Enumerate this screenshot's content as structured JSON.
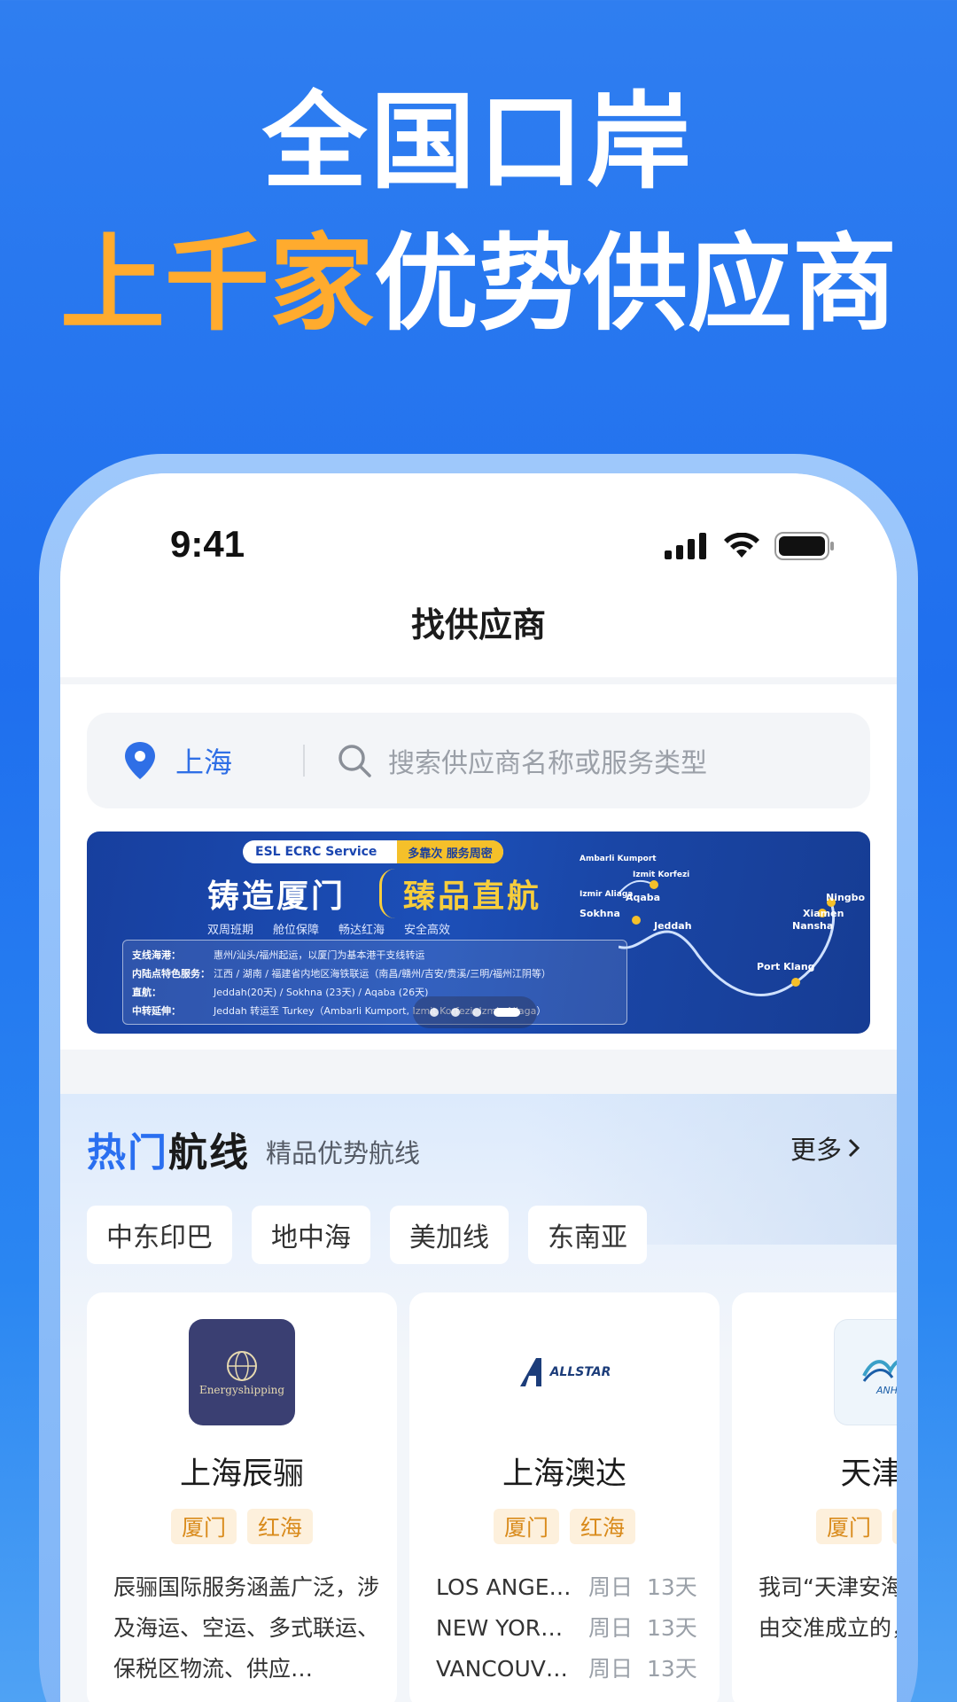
{
  "hero": {
    "line1": "全国口岸",
    "line2_accent": "上千家",
    "line2_rest": "优势供应商"
  },
  "status_bar": {
    "time": "9:41"
  },
  "nav": {
    "title": "找供应商"
  },
  "search": {
    "location": "上海",
    "placeholder": "搜索供应商名称或服务类型"
  },
  "banner": {
    "brand": "ESL",
    "service": "ECRC Service",
    "tagline": "多靠次 服务周密",
    "headline_left": "铸造厦门",
    "headline_right": "臻品直航",
    "features": [
      "双周班期",
      "舱位保障",
      "畅达红海",
      "安全高效"
    ],
    "info_rows": [
      {
        "label": "支线海港：",
        "text": "惠州/汕头/福州起运，以厦门为基本港干支线转运"
      },
      {
        "label": "内陆点特色服务：",
        "text": "江西 / 湖南 / 福建省内地区海铁联运（南昌/赣州/吉安/贵溪/三明/福州江阴等）"
      },
      {
        "label": "直航：",
        "text": "Jeddah(20天) / Sokhna (23天) / Aqaba (26天)"
      },
      {
        "label": "中转延伸：",
        "text": "Jeddah 转运至 Turkey（Ambarli Kumport, Izmit Korfezi, Izmir Aliaga）"
      }
    ],
    "cities": [
      "Ambarli Kumport",
      "Izmit Korfezi",
      "Izmir Aliaga",
      "Aqaba",
      "Sokhna",
      "Jeddah",
      "Port Klang",
      "Ningbo",
      "Xiamen",
      "Nansha"
    ],
    "active_slide": 4,
    "slide_count": 4
  },
  "routes": {
    "title_accent": "热门",
    "title_rest": "航线",
    "subtitle": "精品优势航线",
    "more": "更多",
    "chips": [
      "中东印巴",
      "地中海",
      "美加线",
      "东南亚"
    ]
  },
  "cards": [
    {
      "name": "上海辰骊",
      "logo_text": "Energyshipping",
      "tags": [
        "厦门",
        "红海"
      ],
      "description": "辰骊国际服务涵盖广泛，涉及海运、空运、多式联运、保税区物流、供应…"
    },
    {
      "name": "上海澳达",
      "logo_text": "ALLSTAR",
      "tags": [
        "厦门",
        "红海"
      ],
      "schedule": [
        {
          "port": "LOS ANGE…",
          "day": "周日",
          "duration": "13天"
        },
        {
          "port": "NEW YOR…",
          "day": "周日",
          "duration": "13天"
        },
        {
          "port": "VANCOUV…",
          "day": "周日",
          "duration": "13天"
        }
      ]
    },
    {
      "name": "天津安",
      "logo_text": "ANH",
      "tags": [
        "厦门",
        "红海"
      ],
      "description": "我司“天津安海限公司”是由交准成立的，其实"
    }
  ],
  "colors": {
    "background": "#1f6fee",
    "accent_orange": "#ffab2e",
    "primary_blue": "#2a6ff0",
    "tag_bg": "#fdf0dc",
    "tag_text": "#d98b1c"
  }
}
